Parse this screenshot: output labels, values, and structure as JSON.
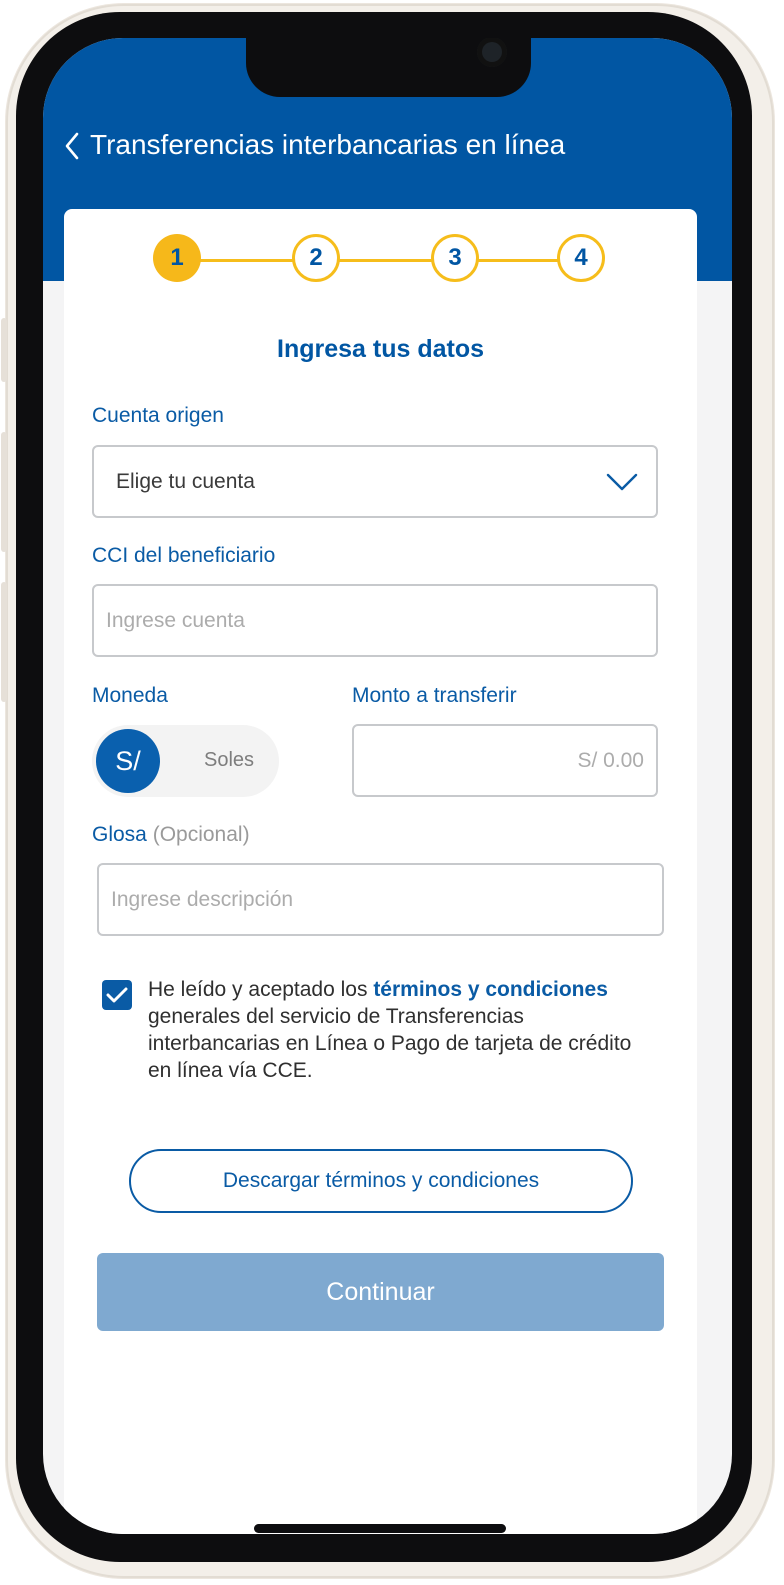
{
  "header": {
    "title": "Transferencias interbancarias en línea",
    "background_color": "#0156a3"
  },
  "stepper": {
    "steps": [
      "1",
      "2",
      "3",
      "4"
    ],
    "current_step": 1,
    "accent_color": "#f6b81a"
  },
  "form": {
    "title": "Ingresa tus datos",
    "cuenta_origen": {
      "label": "Cuenta origen",
      "value": "Elige tu cuenta"
    },
    "cci": {
      "label": "CCI del beneficiario",
      "placeholder": "Ingrese cuenta"
    },
    "moneda": {
      "label": "Moneda",
      "symbol": "S/",
      "name": "Soles"
    },
    "monto": {
      "label": "Monto a transferir",
      "placeholder": "S/ 0.00"
    },
    "glosa": {
      "label": "Glosa",
      "optional_label": "(Opcional)",
      "placeholder": "Ingrese descripción"
    }
  },
  "terms": {
    "checked": true,
    "text_before": "He leído y aceptado los ",
    "link_text": "términos y condiciones",
    "text_after": " generales del servicio de Transferencias interbancarias en Línea o Pago de tarjeta de crédito en línea vía CCE."
  },
  "buttons": {
    "download_label": "Descargar términos y condiciones",
    "continue_label": "Continuar"
  },
  "colors": {
    "primary": "#0a5ba5",
    "continue_disabled": "#7fa9d0"
  }
}
